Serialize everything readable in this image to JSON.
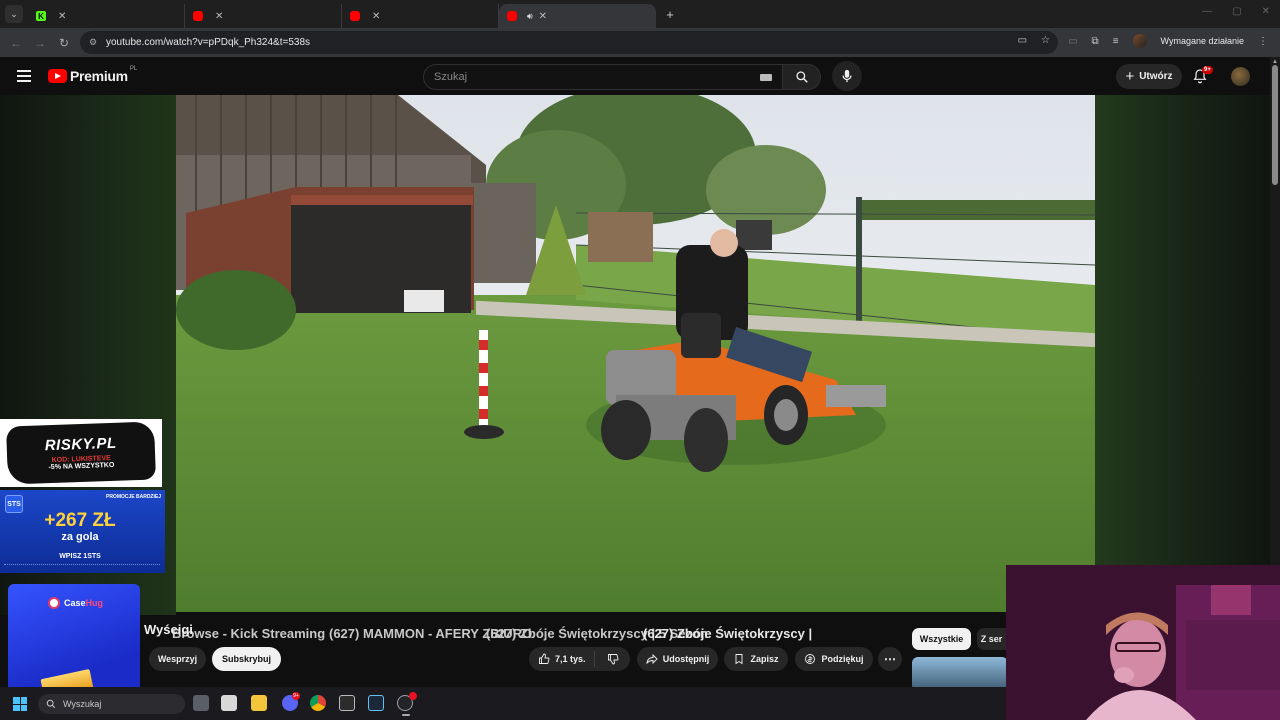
{
  "browser": {
    "tabs": [
      {
        "title": "Browse - Kick Streaming",
        "favicon": "kick-icon",
        "active": false
      },
      {
        "title": "(627) MAMMON - AFERY ZBIURO",
        "favicon": "youtube-icon",
        "active": false
      },
      {
        "title": "(627) Zbóje Świętokrzyscy | 5 Sezon",
        "favicon": "youtube-icon",
        "active": false
      },
      {
        "title": "(627) Zbóje Świętokrzyscy |",
        "favicon": "youtube-icon",
        "active": true,
        "audio": true
      }
    ],
    "url": "youtube.com/watch?v=pPDqk_Ph324&t=538s",
    "required_action": "Wymagane działanie",
    "kick_letter": "K"
  },
  "youtube": {
    "logo_text": "Premium",
    "country": "PL",
    "search_placeholder": "Szukaj",
    "create_label": "Utwórz",
    "notif_badge": "9+",
    "video": {
      "title": "Wyścigi",
      "support_label": "Wesprzyj",
      "subscribe_label": "Subskrybuj",
      "likes": "7,1 tys.",
      "share_label": "Udostępnij",
      "save_label": "Zapisz",
      "thanks_label": "Podziękuj"
    },
    "chips": {
      "all": "Wszystkie",
      "from_series": "Z ser"
    }
  },
  "overlays": {
    "risky": {
      "logo": "RISKY.PL",
      "code": "KOD: LUKISTEVE",
      "promo": "-5% NA WSZYSTKO"
    },
    "sts": {
      "logo": "STS",
      "promo": "PROMOCJE BARDZIEJ",
      "amount": "+267 ZŁ",
      "sub": "za gola",
      "code": "WPISZ 1STS"
    },
    "casehug": {
      "name_a": "Case",
      "name_b": "Hug"
    }
  },
  "taskbar": {
    "search_placeholder": "Wyszukaj",
    "discord_badge": "9+"
  },
  "colors": {
    "yt_red": "#ff0000",
    "accent_blue": "#1c47c9"
  }
}
